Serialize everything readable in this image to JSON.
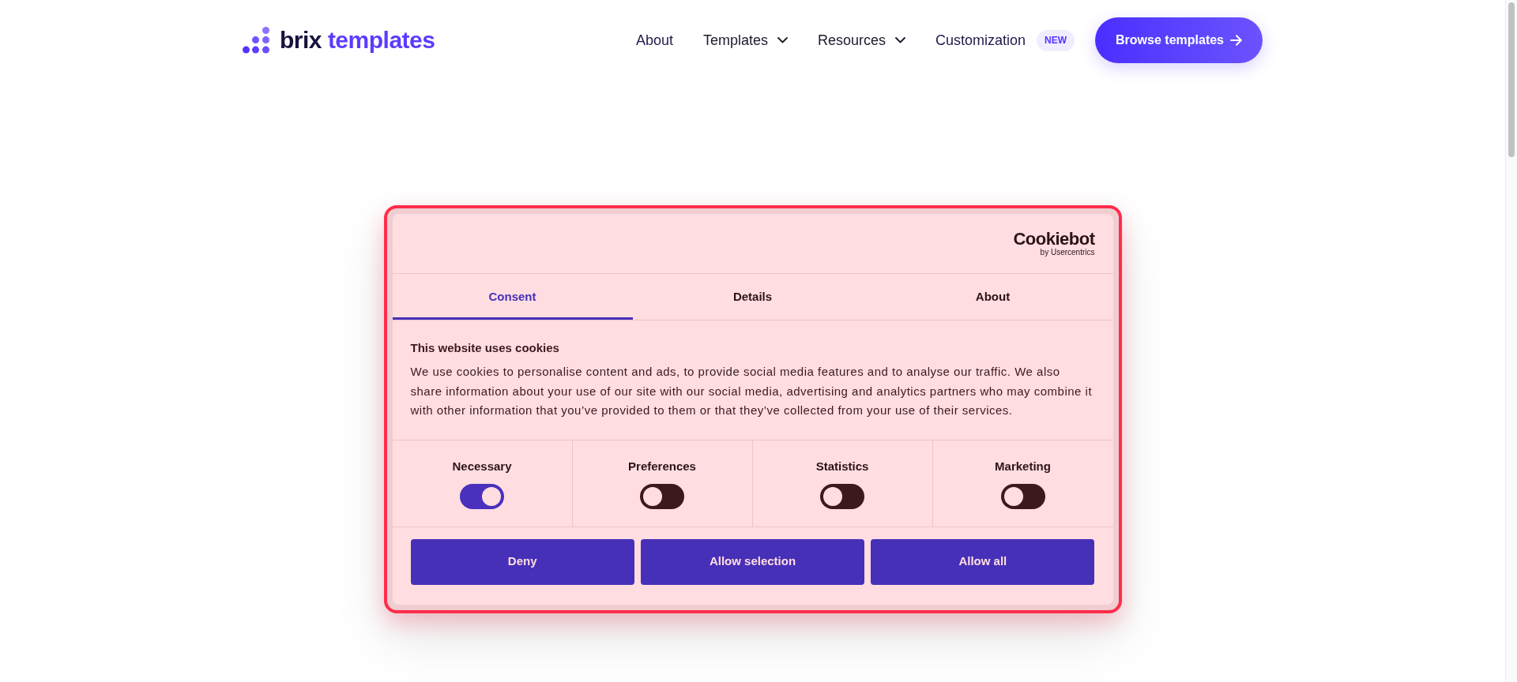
{
  "header": {
    "logo": {
      "word_1": "brix",
      "word_2": "templates"
    },
    "nav": [
      {
        "label": "About",
        "kind": "link"
      },
      {
        "label": "Templates",
        "kind": "dropdown"
      },
      {
        "label": "Resources",
        "kind": "dropdown"
      },
      {
        "label": "Customization",
        "kind": "link",
        "badge": "NEW"
      }
    ],
    "cta": {
      "label": "Browse templates"
    }
  },
  "cookie_dialog": {
    "brand": {
      "name": "Cookiebot",
      "byline": "by Usercentrics"
    },
    "tabs": [
      {
        "label": "Consent",
        "selected": true
      },
      {
        "label": "Details",
        "selected": false
      },
      {
        "label": "About",
        "selected": false
      }
    ],
    "title": "This website uses cookies",
    "message": "We use cookies to personalise content and ads, to provide social media features and to analyse our traffic. We also share information about your use of our site with our social media, advertising and analytics partners who may combine it with other information that you’ve provided to them or that they’ve collected from your use of their services.",
    "categories": [
      {
        "label": "Necessary",
        "on": true
      },
      {
        "label": "Preferences",
        "on": false
      },
      {
        "label": "Statistics",
        "on": false
      },
      {
        "label": "Marketing",
        "on": false
      }
    ],
    "buttons": [
      "Deny",
      "Allow selection",
      "Allow all"
    ]
  }
}
